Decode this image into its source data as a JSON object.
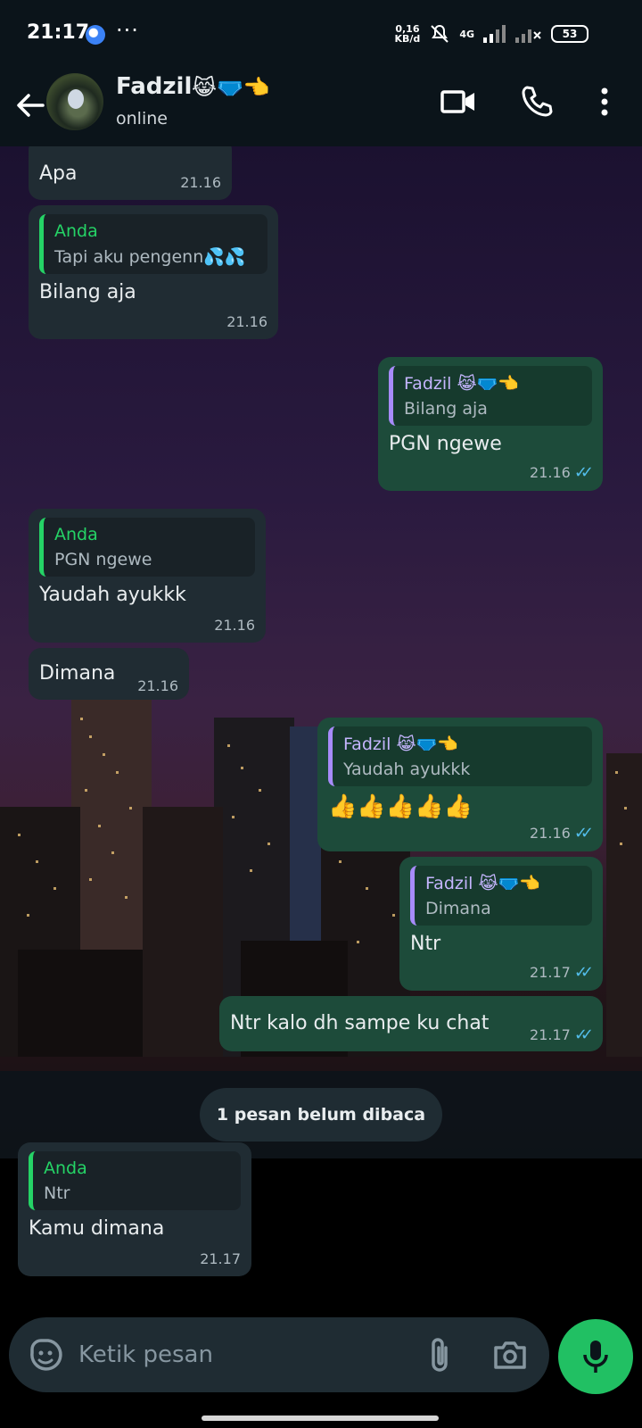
{
  "status_bar": {
    "time": "21:17",
    "more": "···",
    "speed": "0,16\nKB/d",
    "network": "4G",
    "battery": "53"
  },
  "header": {
    "contact_name": "Fadzil",
    "contact_emoji": "😹🩲👈",
    "status": "online"
  },
  "messages": [
    {
      "direction": "in",
      "text": "Apa",
      "time": "21.16"
    },
    {
      "direction": "in",
      "reply_author": "Anda",
      "reply_text": "Tapi aku pengenn💦💦",
      "text": "Bilang aja",
      "time": "21.16"
    },
    {
      "direction": "out",
      "reply_author": "Fadzil 😹🩲👈",
      "reply_text": "Bilang aja",
      "text": "PGN ngewe",
      "time": "21.16"
    },
    {
      "direction": "in",
      "reply_author": "Anda",
      "reply_text": "PGN ngewe",
      "text": "Yaudah ayukkk",
      "time": "21.16"
    },
    {
      "direction": "in",
      "text": "Dimana",
      "time": "21.16"
    },
    {
      "direction": "out",
      "reply_author": "Fadzil 😹🩲👈",
      "reply_text": "Yaudah ayukkk",
      "text": "👍👍👍👍👍",
      "time": "21.16"
    },
    {
      "direction": "out",
      "reply_author": "Fadzil 😹🩲👈",
      "reply_text": "Dimana",
      "text": "Ntr",
      "time": "21.17"
    },
    {
      "direction": "out",
      "text": "Ntr kalo dh sampe ku chat",
      "time": "21.17"
    },
    {
      "direction": "in",
      "reply_author": "Anda",
      "reply_text": "Ntr",
      "text": "Kamu dimana",
      "time": "21.17"
    }
  ],
  "unread_label": "1 pesan belum dibaca",
  "input": {
    "placeholder": "Ketik pesan"
  },
  "colors": {
    "accent": "#25d366",
    "incoming": "#202c33",
    "outgoing": "#1d4b3a",
    "read_tick": "#53bdeb"
  }
}
